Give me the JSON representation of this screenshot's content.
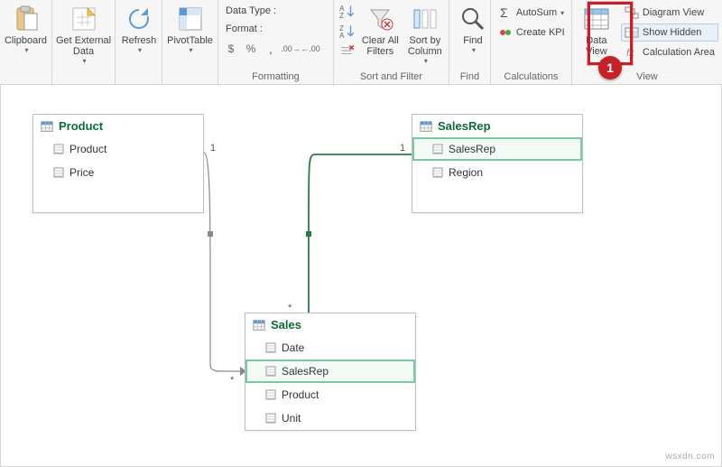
{
  "ribbon": {
    "clipboard": {
      "label": "Clipboard"
    },
    "get_external_data": {
      "label": "Get External\nData"
    },
    "refresh": {
      "label": "Refresh"
    },
    "pivottable": {
      "label": "PivotTable"
    },
    "formatting": {
      "data_type": "Data Type :",
      "format": "Format :",
      "group": "Formatting"
    },
    "sort_filter": {
      "clear_all": "Clear All\nFilters",
      "sort_by": "Sort by\nColumn",
      "group": "Sort and Filter"
    },
    "find": {
      "label": "Find",
      "group": "Find"
    },
    "calculations": {
      "autosum": "AutoSum",
      "create_kpi": "Create KPI",
      "group": "Calculations"
    },
    "view": {
      "data_view": "Data\nView",
      "diagram_view": "Diagram View",
      "show_hidden": "Show Hidden",
      "calc_area": "Calculation Area",
      "group": "View"
    }
  },
  "tables": {
    "product": {
      "title": "Product",
      "fields": [
        "Product",
        "Price"
      ]
    },
    "salesrep": {
      "title": "SalesRep",
      "fields": [
        "SalesRep",
        "Region"
      ],
      "selected_index": 0
    },
    "sales": {
      "title": "Sales",
      "fields": [
        "Date",
        "SalesRep",
        "Product",
        "Unit"
      ],
      "selected_index": 1
    }
  },
  "cardinality": {
    "one": "1",
    "many": "*"
  },
  "callout": {
    "number": "1"
  },
  "watermark": "wsxdn.com"
}
